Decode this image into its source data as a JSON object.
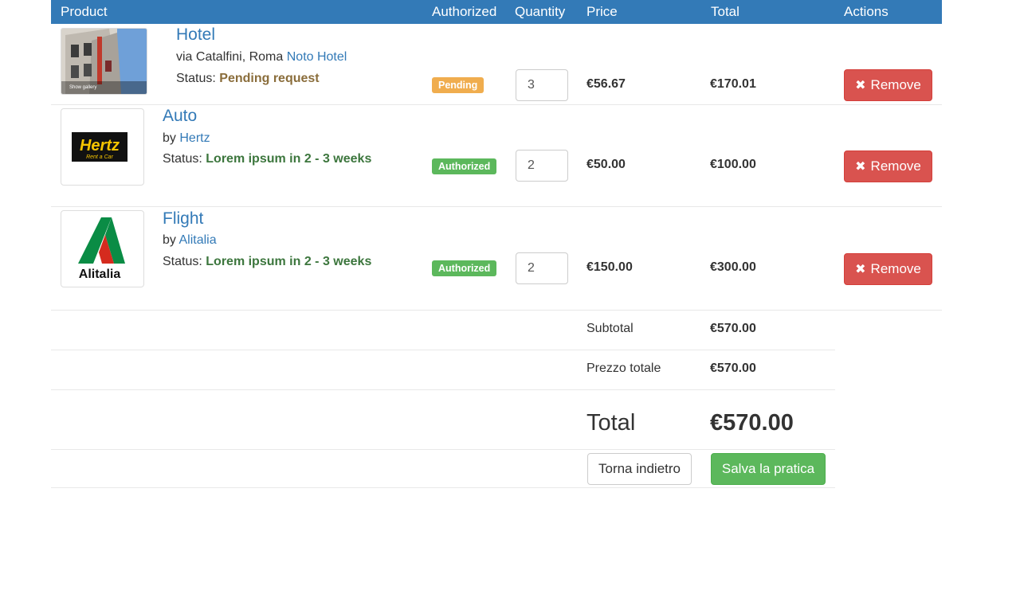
{
  "table": {
    "headers": {
      "product": "Product",
      "authorized": "Authorized",
      "quantity": "Quantity",
      "price": "Price",
      "total": "Total",
      "actions": "Actions"
    },
    "rows": [
      {
        "name": "Hotel",
        "line_prefix": "via Catalfini, Roma",
        "line_link": "Noto Hotel",
        "status_prefix": "Status:",
        "status_value": "Pending request",
        "thumb_caption": "Show gallery",
        "badge": "Pending",
        "quantity": "3",
        "price": "€56.67",
        "total": "€170.01",
        "remove_label": "Remove"
      },
      {
        "name": "Auto",
        "line_prefix": "by",
        "line_link": "Hertz",
        "status_prefix": "Status:",
        "status_value": "Lorem ipsum in 2 - 3 weeks",
        "logo_text": "Hertz",
        "logo_subtext": "Rent a Car",
        "badge": "Authorized",
        "quantity": "2",
        "price": "€50.00",
        "total": "€100.00",
        "remove_label": "Remove"
      },
      {
        "name": "Flight",
        "line_prefix": "by",
        "line_link": "Alitalia",
        "status_prefix": "Status:",
        "status_value": "Lorem ipsum in 2 - 3 weeks",
        "logo_text": "Alitalia",
        "badge": "Authorized",
        "quantity": "2",
        "price": "€150.00",
        "total": "€300.00",
        "remove_label": "Remove"
      }
    ]
  },
  "summary": {
    "subtotal_label": "Subtotal",
    "subtotal_value": "€570.00",
    "prezzo_label": "Prezzo totale",
    "prezzo_value": "€570.00",
    "total_label": "Total",
    "total_value": "€570.00"
  },
  "buttons": {
    "back": "Torna indietro",
    "save": "Salva la pratica"
  },
  "colors": {
    "header": "#337ab7",
    "danger": "#d9534f",
    "success": "#5cb85c",
    "warning": "#f0ad4e"
  },
  "icons": {
    "remove": "times-icon"
  }
}
